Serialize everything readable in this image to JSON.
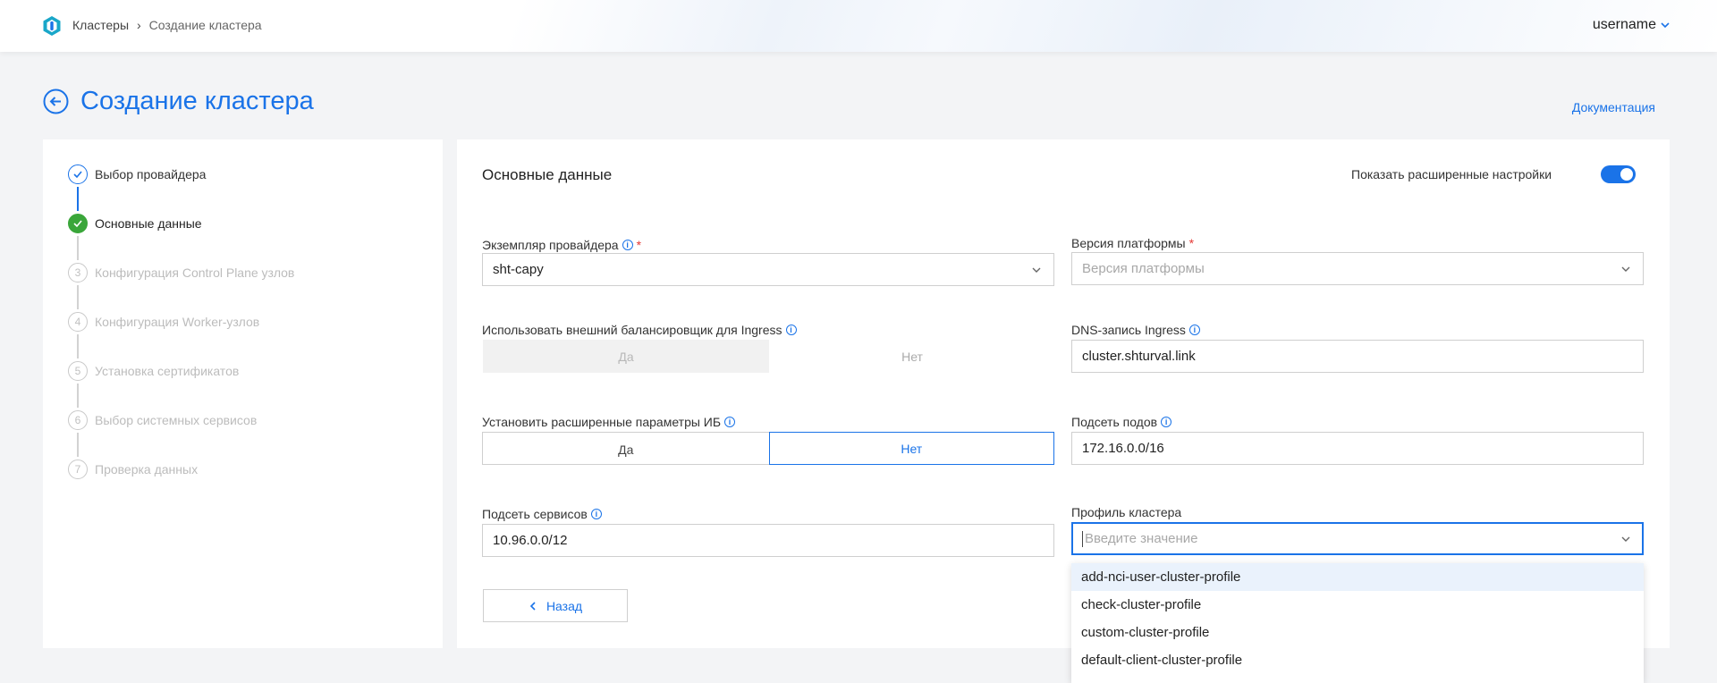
{
  "breadcrumb": {
    "root": "Кластеры",
    "separator": "›",
    "current": "Создание кластера"
  },
  "user": {
    "name": "username"
  },
  "page": {
    "title": "Создание кластера",
    "docs_link": "Документация"
  },
  "steps": [
    {
      "num": "1",
      "label": "Выбор провайдера",
      "state": "done"
    },
    {
      "num": "2",
      "label": "Основные данные",
      "state": "active"
    },
    {
      "num": "3",
      "label": "Конфигурация Control Plane узлов",
      "state": "pending"
    },
    {
      "num": "4",
      "label": "Конфигурация Worker-узлов",
      "state": "pending"
    },
    {
      "num": "5",
      "label": "Установка сертификатов",
      "state": "pending"
    },
    {
      "num": "6",
      "label": "Выбор системных сервисов",
      "state": "pending"
    },
    {
      "num": "7",
      "label": "Проверка данных",
      "state": "pending"
    }
  ],
  "form": {
    "section_title": "Основные данные",
    "advanced_toggle_label": "Показать расширенные настройки",
    "advanced_toggle_on": true,
    "provider_instance": {
      "label": "Экземпляр провайдера",
      "required": "*",
      "value": "sht-capy"
    },
    "platform_version": {
      "label": "Версия платформы",
      "required": "*",
      "placeholder": "Версия платформы"
    },
    "external_lb": {
      "label": "Использовать внешний балансировщик для Ingress",
      "yes": "Да",
      "no": "Нет",
      "selected": "Да"
    },
    "dns_ingress": {
      "label": "DNS-запись Ingress",
      "value": "cluster.shturval.link"
    },
    "ib_params": {
      "label": "Установить расширенные параметры ИБ",
      "yes": "Да",
      "no": "Нет",
      "selected": "Нет"
    },
    "pod_subnet": {
      "label": "Подсеть подов",
      "value": "172.16.0.0/16"
    },
    "service_subnet": {
      "label": "Подсеть сервисов",
      "value": "10.96.0.0/12"
    },
    "cluster_profile": {
      "label": "Профиль кластера",
      "placeholder": "Введите значение",
      "options": [
        "add-nci-user-cluster-profile",
        "check-cluster-profile",
        "custom-cluster-profile",
        "default-client-cluster-profile"
      ],
      "highlighted": "add-nci-user-cluster-profile"
    },
    "back_button": "Назад"
  },
  "colors": {
    "accent": "#1a73e8",
    "success": "#3aa63a",
    "required": "#e53935"
  }
}
